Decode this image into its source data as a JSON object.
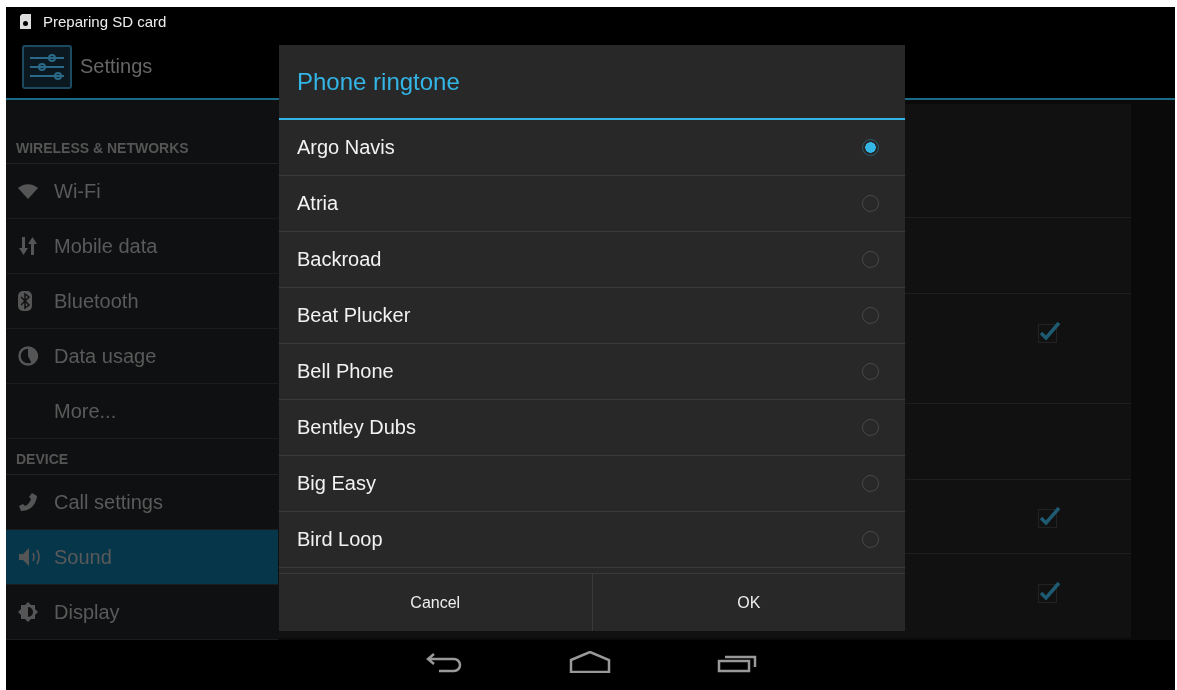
{
  "status_bar": {
    "notification": "Preparing SD card"
  },
  "action_bar": {
    "title": "Settings"
  },
  "sidebar": {
    "sections": [
      {
        "header": "WIRELESS & NETWORKS",
        "items": [
          {
            "label": "Wi-Fi",
            "kind": "wifi",
            "selected": false
          },
          {
            "label": "Mobile data",
            "kind": "data",
            "selected": false
          },
          {
            "label": "Bluetooth",
            "kind": "bluetooth",
            "selected": false
          },
          {
            "label": "Data usage",
            "kind": "usage",
            "selected": false
          },
          {
            "label": "More...",
            "kind": "more",
            "selected": false
          }
        ]
      },
      {
        "header": "DEVICE",
        "items": [
          {
            "label": "Call settings",
            "kind": "call",
            "selected": false
          },
          {
            "label": "Sound",
            "kind": "sound",
            "selected": true
          },
          {
            "label": "Display",
            "kind": "display",
            "selected": false
          }
        ]
      }
    ]
  },
  "detail_rows": [
    {
      "kind": "plain"
    },
    {
      "kind": "plain"
    },
    {
      "kind": "checkbox",
      "checked": true
    },
    {
      "kind": "plain"
    },
    {
      "kind": "checkbox",
      "checked": true
    },
    {
      "kind": "checkbox",
      "checked": true
    }
  ],
  "dialog": {
    "title": "Phone ringtone",
    "options": [
      {
        "label": "Argo Navis",
        "selected": true
      },
      {
        "label": "Atria",
        "selected": false
      },
      {
        "label": "Backroad",
        "selected": false
      },
      {
        "label": "Beat Plucker",
        "selected": false
      },
      {
        "label": "Bell Phone",
        "selected": false
      },
      {
        "label": "Bentley Dubs",
        "selected": false
      },
      {
        "label": "Big Easy",
        "selected": false
      },
      {
        "label": "Bird Loop",
        "selected": false
      }
    ],
    "buttons": [
      "Cancel",
      "OK"
    ]
  }
}
